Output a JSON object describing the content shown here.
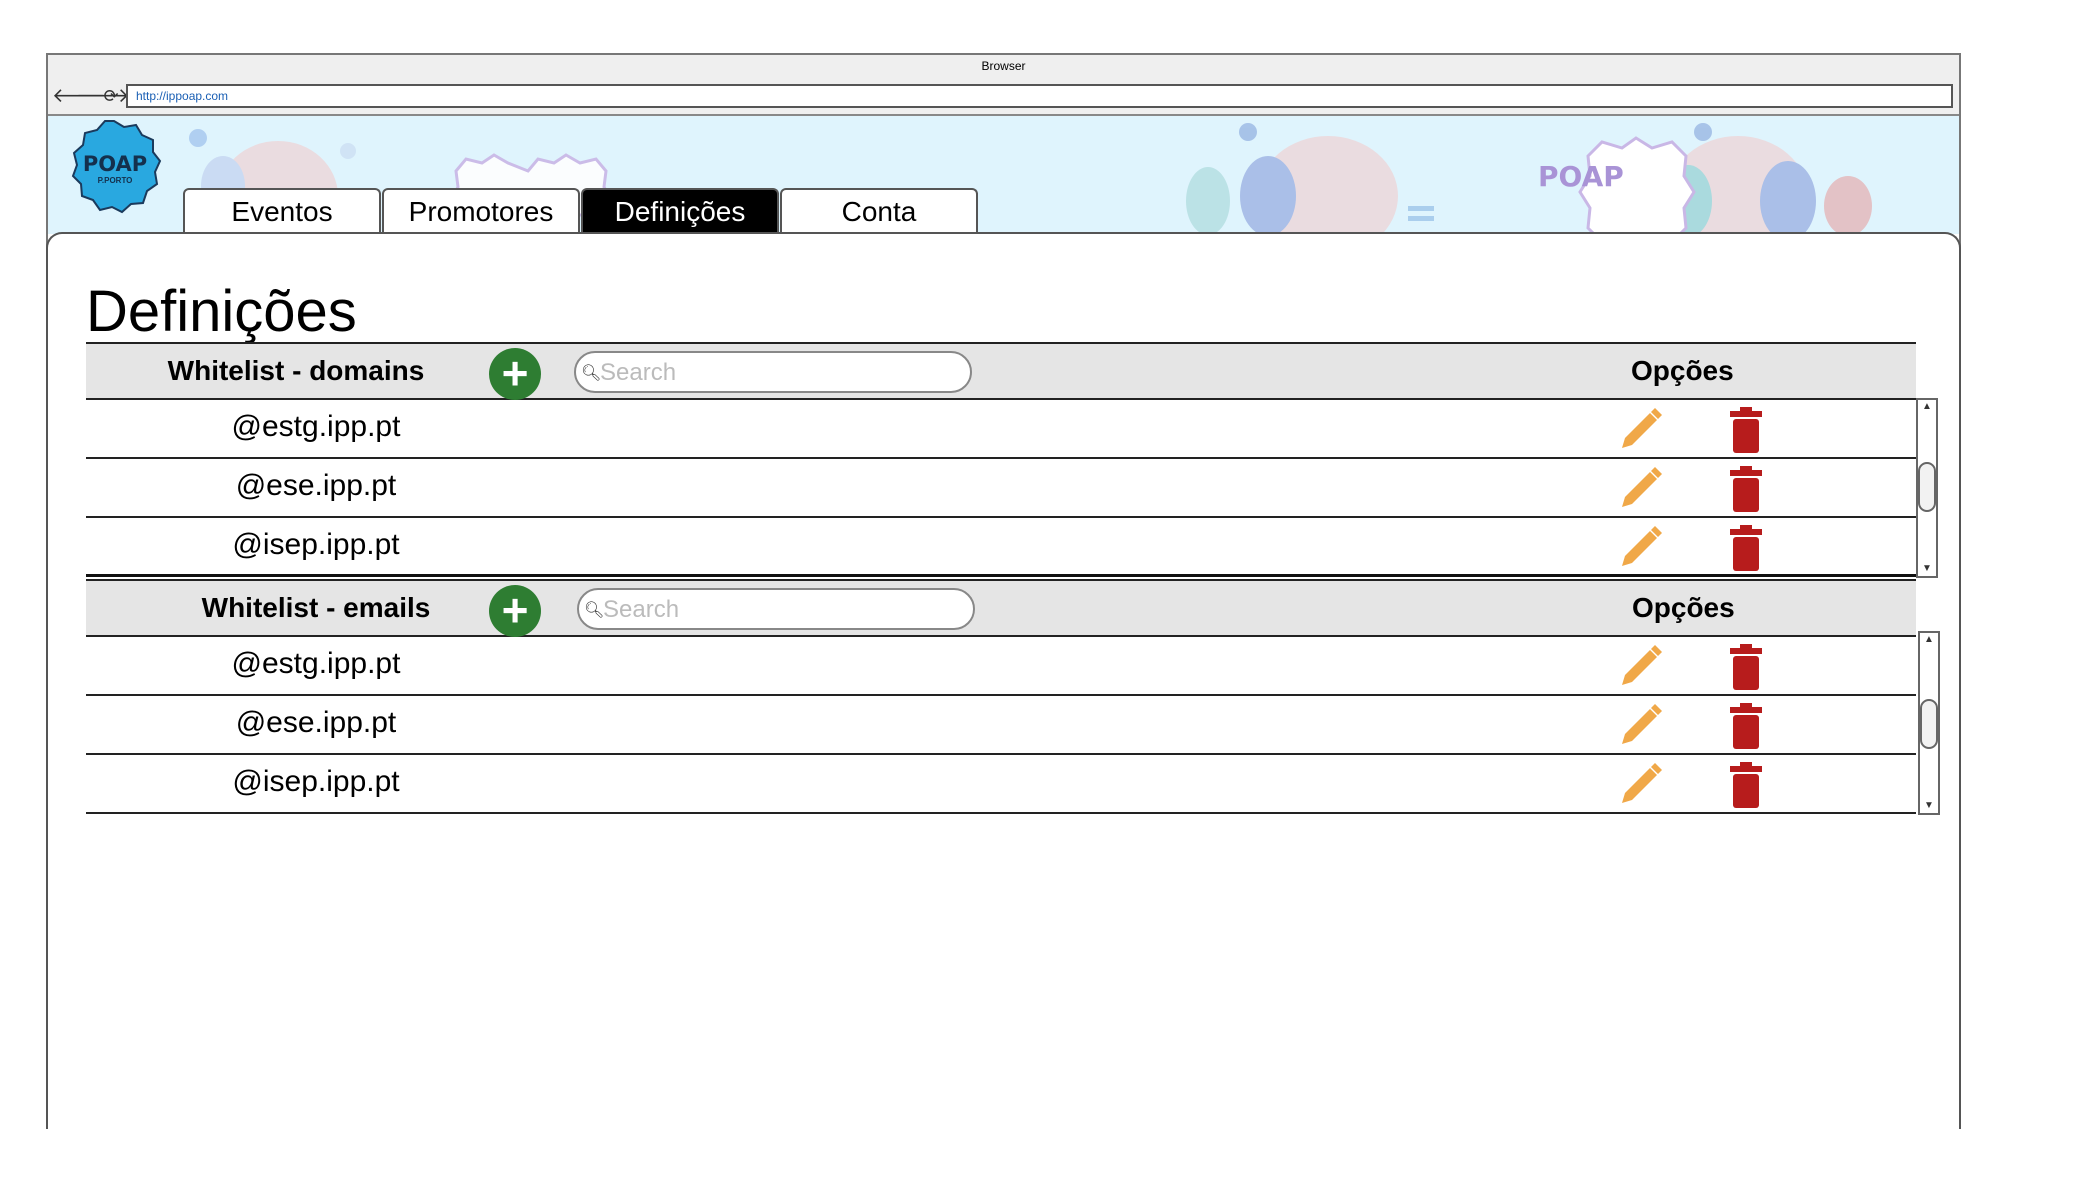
{
  "browser": {
    "title": "Browser",
    "url": "http://ippoap.com"
  },
  "logo": {
    "text": "POAP",
    "subtext": "P.PORTO"
  },
  "tabs": [
    {
      "label": "Eventos",
      "active": false
    },
    {
      "label": "Promotores",
      "active": false
    },
    {
      "label": "Definições",
      "active": true
    },
    {
      "label": "Conta",
      "active": false
    }
  ],
  "page": {
    "title": "Definições"
  },
  "sections": [
    {
      "title": "Whitelist - domains",
      "search_placeholder": "Search",
      "options_label": "Opções",
      "rows": [
        "@estg.ipp.pt",
        "@ese.ipp.pt",
        "@isep.ipp.pt"
      ]
    },
    {
      "title": "Whitelist - emails",
      "search_placeholder": "Search",
      "options_label": "Opções",
      "rows": [
        "@estg.ipp.pt",
        "@ese.ipp.pt",
        "@isep.ipp.pt"
      ]
    }
  ],
  "colors": {
    "add": "#2e7d32",
    "edit": "#f0a848",
    "delete": "#b71c1c",
    "active_tab": "#000000",
    "banner": "#dff4fd"
  },
  "icons": {
    "add": "plus-icon",
    "search": "magnifier-icon",
    "edit": "pencil-icon",
    "delete": "trash-icon"
  }
}
